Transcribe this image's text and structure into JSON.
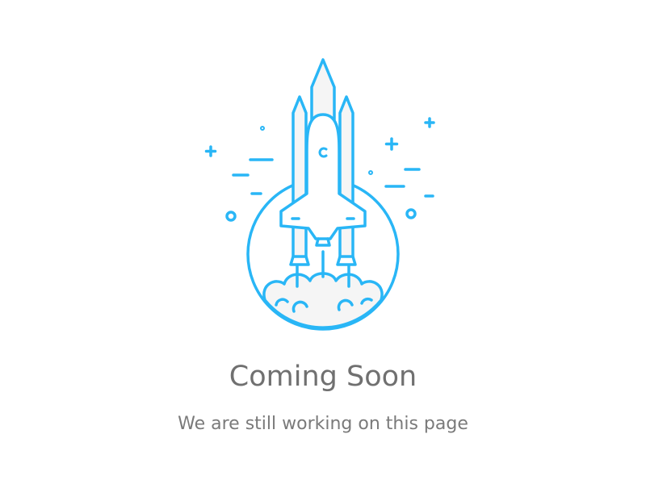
{
  "page": {
    "title": "Coming Soon",
    "subtitle": "We are still working on this page"
  },
  "illustration": {
    "icon": "rocket-launch-icon",
    "accent_color": "#29b6f6",
    "fill_color": "#f5f5f5"
  }
}
